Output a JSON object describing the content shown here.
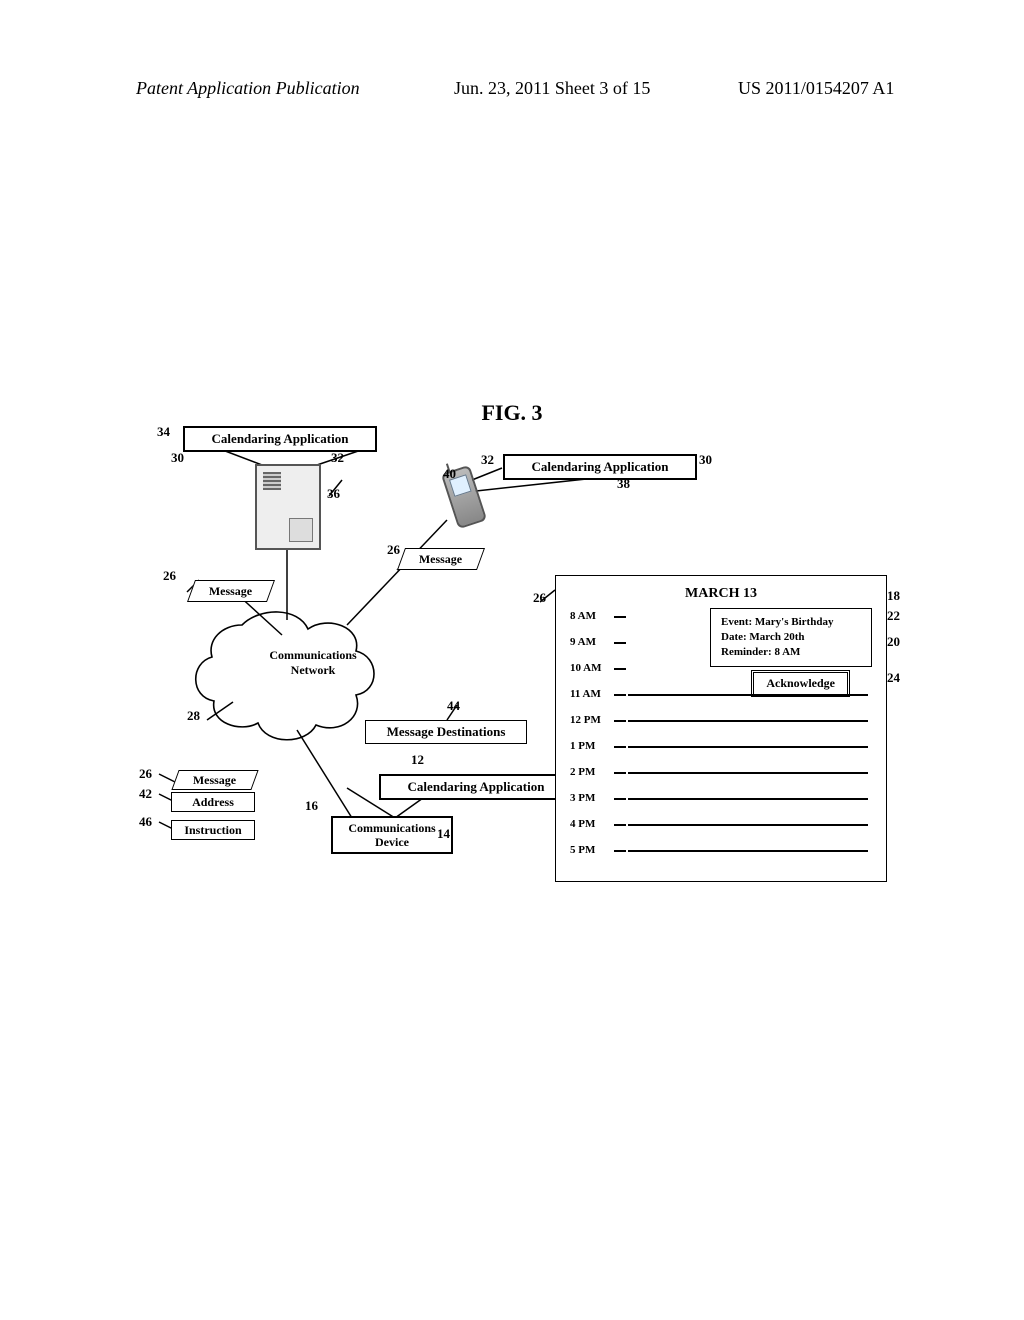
{
  "header": {
    "left": "Patent Application Publication",
    "mid": "Jun. 23, 2011  Sheet 3 of 15",
    "right": "US 2011/0154207 A1"
  },
  "figure_number": "FIG. 3",
  "labels": {
    "cal_app": "Calendaring Application",
    "message": "Message",
    "comm_network": "Communications\nNetwork",
    "msg_dest": "Message Destinations",
    "address": "Address",
    "instruction": "Instruction",
    "comm_device": "Communications\nDevice",
    "acknowledge": "Acknowledge"
  },
  "calendar": {
    "title": "MARCH 13",
    "event_line1": "Event: Mary's Birthday",
    "event_line2": "Date: March 20th",
    "event_line3": "Reminder: 8 AM",
    "times": [
      "8 AM",
      "9 AM",
      "10 AM",
      "11 AM",
      "12 PM",
      "1 PM",
      "2 PM",
      "3 PM",
      "4 PM",
      "5 PM"
    ]
  },
  "refs": {
    "r12": "12",
    "r14": "14",
    "r16": "16",
    "r18": "18",
    "r20": "20",
    "r22": "22",
    "r24": "24",
    "r26a": "26",
    "r26b": "26",
    "r26c": "26",
    "r26d": "26",
    "r28": "28",
    "r30a": "30",
    "r30b": "30",
    "r32a": "32",
    "r32b": "32",
    "r34": "34",
    "r36": "36",
    "r38": "38",
    "r40": "40",
    "r42": "42",
    "r44": "44",
    "r46": "46"
  }
}
